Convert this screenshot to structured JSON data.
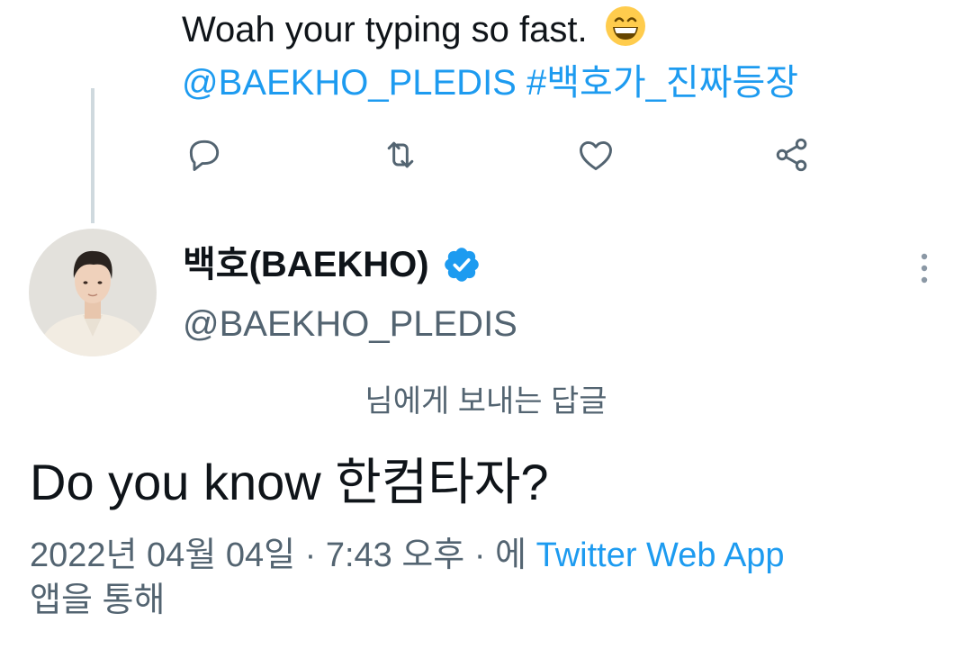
{
  "parent_tweet": {
    "text": "Woah your typing so fast.",
    "emoji_icon": "grinning-face-with-smiling-eyes-emoji",
    "mention": "@BAEKHO_PLEDIS",
    "hashtag": "#백호가_진짜등장"
  },
  "actions": {
    "reply_icon": "reply-icon",
    "retweet_icon": "retweet-icon",
    "like_icon": "like-heart-icon",
    "share_icon": "share-icon"
  },
  "reply": {
    "display_name": "백호(BAEKHO)",
    "handle": "@BAEKHO_PLEDIS",
    "verified_icon": "verified-badge-icon",
    "more_icon": "more-options-icon",
    "replying_to": "님에게 보내는 답글",
    "text": "Do you know 한컴타자?",
    "timestamp": "2022년 04월 04일 · 7:43 오후 · 에",
    "source": "Twitter Web App",
    "source_suffix": "앱을 통해"
  },
  "colors": {
    "accent": "#1d9bf0",
    "text_primary": "#0f1419",
    "text_secondary": "#536471",
    "thread_line": "#cfd9de",
    "icon": "#536471"
  }
}
